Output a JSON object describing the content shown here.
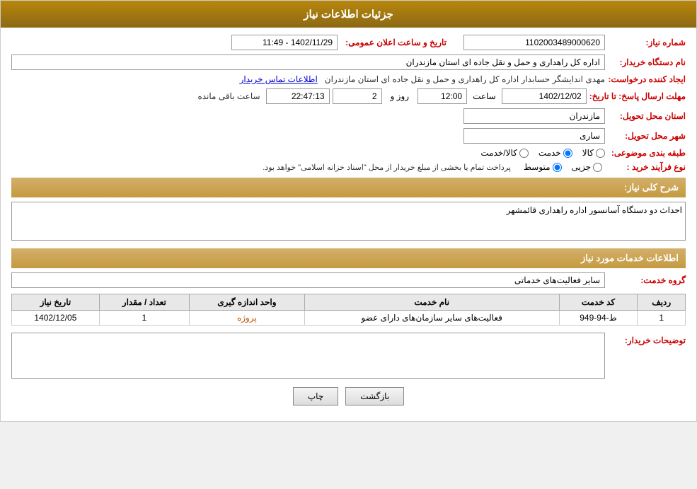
{
  "header": {
    "title": "جزئیات اطلاعات نیاز"
  },
  "fields": {
    "need_number_label": "شماره نیاز:",
    "need_number_value": "1102003489000620",
    "announce_datetime_label": "تاریخ و ساعت اعلان عمومی:",
    "announce_datetime_value": "1402/11/29 - 11:49",
    "buyer_name_label": "نام دستگاه خریدار:",
    "buyer_name_value": "اداره کل راهداری و حمل و نقل جاده ای استان مازندران",
    "creator_label": "ایجاد کننده درخواست:",
    "creator_name": "مهدی اندایشگر حسابدار اداره کل راهداری و حمل و نقل جاده ای استان مازندران",
    "creator_link": "اطلاعات تماس خریدار",
    "response_deadline_label": "مهلت ارسال پاسخ: تا تاریخ:",
    "response_date": "1402/12/02",
    "response_time_label": "ساعت",
    "response_time": "12:00",
    "response_days_label": "روز و",
    "response_days": "2",
    "response_remaining_label": "ساعت باقی مانده",
    "response_remaining": "22:47:13",
    "province_label": "استان محل تحویل:",
    "province_value": "مازندران",
    "city_label": "شهر محل تحویل:",
    "city_value": "ساری",
    "category_label": "طبقه بندی موضوعی:",
    "category_options": [
      {
        "label": "کالا",
        "value": "kala"
      },
      {
        "label": "خدمت",
        "value": "khedmat"
      },
      {
        "label": "کالا/خدمت",
        "value": "kala_khedmat"
      }
    ],
    "category_selected": "khedmat",
    "purchase_type_label": "نوع فرآیند خرید :",
    "purchase_type_options": [
      {
        "label": "جزیی",
        "value": "jozi"
      },
      {
        "label": "متوسط",
        "value": "motavasset"
      }
    ],
    "purchase_type_selected": "motavasset",
    "purchase_type_desc": "پرداخت تمام یا بخشی از مبلغ خریدار از محل \"اسناد خزانه اسلامی\" خواهد بود.",
    "need_description_label": "شرح کلی نیاز:",
    "need_description_value": "احداث دو دستگاه آسانسور اداره راهداری قائمشهر",
    "services_section_title": "اطلاعات خدمات مورد نیاز",
    "service_group_label": "گروه خدمت:",
    "service_group_value": "سایر فعالیت‌های خدماتی",
    "table_headers": [
      "ردیف",
      "کد خدمت",
      "نام خدمت",
      "واحد اندازه گیری",
      "تعداد / مقدار",
      "تاریخ نیاز"
    ],
    "table_rows": [
      {
        "row": "1",
        "service_code": "ط-94-949",
        "service_name": "فعالیت‌های سایر سازمان‌های دارای عضو",
        "unit": "پروژه",
        "quantity": "1",
        "date": "1402/12/05"
      }
    ],
    "buyer_desc_label": "توضیحات خریدار:",
    "buyer_desc_value": "",
    "btn_back": "بازگشت",
    "btn_print": "چاپ"
  }
}
